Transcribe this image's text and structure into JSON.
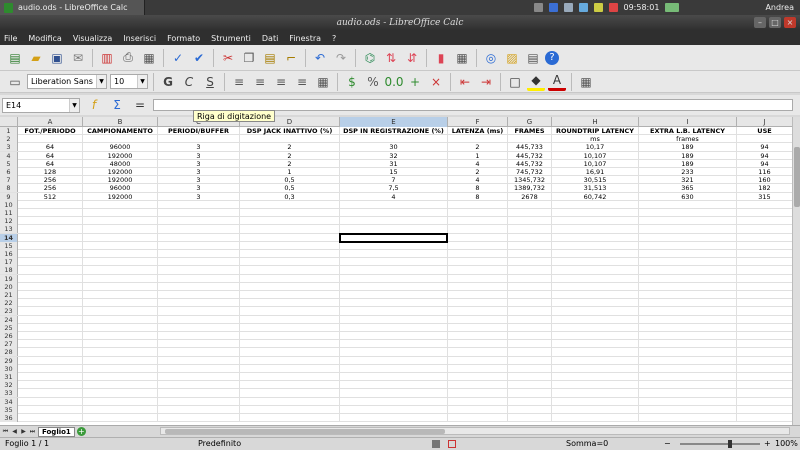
{
  "taskbar": {
    "window_button": "audio.ods - LibreOffice Calc",
    "clock": "09:58:01",
    "user": "Andrea"
  },
  "window": {
    "title": "audio.ods - LibreOffice Calc"
  },
  "menu": [
    "File",
    "Modifica",
    "Visualizza",
    "Inserisci",
    "Formato",
    "Strumenti",
    "Dati",
    "Finestra",
    "?"
  ],
  "format_toolbar": {
    "font_name": "Liberation Sans",
    "font_size": "10"
  },
  "formula_bar": {
    "cell_reference": "E14",
    "content": "",
    "tooltip": "Riga di digitazione"
  },
  "columns": [
    "A",
    "B",
    "C",
    "D",
    "E",
    "F",
    "G",
    "H",
    "I",
    "J"
  ],
  "selected_column": "E",
  "selected_row": 14,
  "sheet": {
    "headers": [
      "FOT./PERIODO",
      "CAMPIONAMENTO",
      "PERIODI/BUFFER",
      "DSP JACK INATTIVO (%)",
      "DSP IN REGISTRAZIONE (%)",
      "LATENZA (ms)",
      "FRAMES",
      "ROUNDTRIP LATENCY",
      "EXTRA L.B. LATENCY",
      "USE"
    ],
    "subheaders": [
      "",
      "",
      "",
      "",
      "",
      "",
      "",
      "ms",
      "frames",
      ""
    ],
    "rows": [
      [
        "64",
        "96000",
        "3",
        "2",
        "30",
        "2",
        "445,733",
        "10,17",
        "189",
        "94"
      ],
      [
        "64",
        "192000",
        "3",
        "2",
        "32",
        "1",
        "445,732",
        "10,107",
        "189",
        "94"
      ],
      [
        "64",
        "48000",
        "3",
        "2",
        "31",
        "4",
        "445,732",
        "10,107",
        "189",
        "94"
      ],
      [
        "128",
        "192000",
        "3",
        "1",
        "15",
        "2",
        "745,732",
        "16,91",
        "233",
        "116"
      ],
      [
        "256",
        "192000",
        "3",
        "0,5",
        "7",
        "4",
        "1345,732",
        "30,515",
        "321",
        "160"
      ],
      [
        "256",
        "96000",
        "3",
        "0,5",
        "7,5",
        "8",
        "1389,732",
        "31,513",
        "365",
        "182"
      ],
      [
        "512",
        "192000",
        "3",
        "0,3",
        "4",
        "8",
        "2678",
        "60,742",
        "630",
        "315"
      ]
    ],
    "row_numbers": [
      "1",
      "2",
      "3",
      "4",
      "5",
      "6",
      "7",
      "8",
      "9",
      "10",
      "11",
      "12",
      "13",
      "14",
      "15",
      "16",
      "17",
      "18",
      "19",
      "20",
      "21",
      "22",
      "23",
      "24",
      "25",
      "26",
      "27",
      "28",
      "29",
      "30",
      "31",
      "32",
      "33",
      "34",
      "35",
      "36"
    ]
  },
  "tabs": {
    "sheet_name": "Foglio1"
  },
  "status": {
    "sheet_info": "Foglio 1 / 1",
    "page_style": "Predefinito",
    "sum": "Somma=0",
    "zoom": "100%"
  }
}
